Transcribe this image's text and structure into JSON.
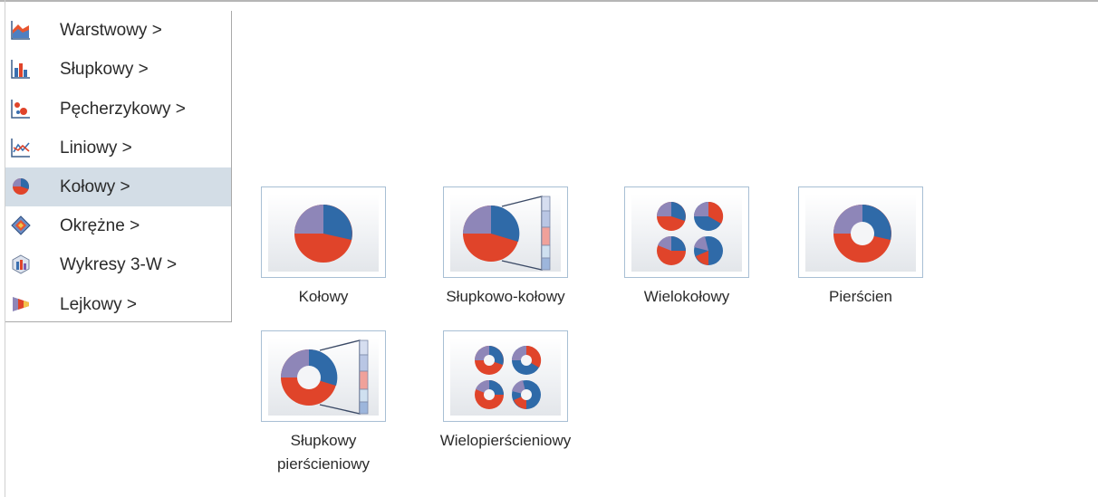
{
  "menu": {
    "items": [
      {
        "label": "Warstwowy  >",
        "icon": "area-chart-icon"
      },
      {
        "label": "Słupkowy  >",
        "icon": "bar-chart-icon"
      },
      {
        "label": "Pęcherzykowy  >",
        "icon": "bubble-chart-icon"
      },
      {
        "label": "Liniowy  >",
        "icon": "line-chart-icon"
      },
      {
        "label": "Kołowy  >",
        "icon": "pie-chart-icon",
        "selected": true
      },
      {
        "label": "Okrężne  >",
        "icon": "radar-chart-icon"
      },
      {
        "label": "Wykresy 3-W  >",
        "icon": "3d-chart-icon"
      },
      {
        "label": "Lejkowy  >",
        "icon": "funnel-chart-icon"
      }
    ]
  },
  "subtypes": [
    {
      "label": "Kołowy",
      "icon": "pie-icon"
    },
    {
      "label": "Słupkowo-kołowy",
      "icon": "bar-of-pie-icon"
    },
    {
      "label": "Wielokołowy",
      "icon": "multi-pie-icon"
    },
    {
      "label": "Pierścien",
      "icon": "doughnut-icon"
    },
    {
      "label_line1": "Słupkowy",
      "label_line2": "pierścieniowy",
      "icon": "bar-of-doughnut-icon"
    },
    {
      "label": "Wielopierścieniowy",
      "icon": "multi-doughnut-icon"
    }
  ],
  "colors": {
    "selection": "#d3dde6",
    "tile_border": "#a8bfd4",
    "pie_blue": "#2f6aa8",
    "pie_red": "#e0442a",
    "pie_purple": "#8e86b8"
  }
}
